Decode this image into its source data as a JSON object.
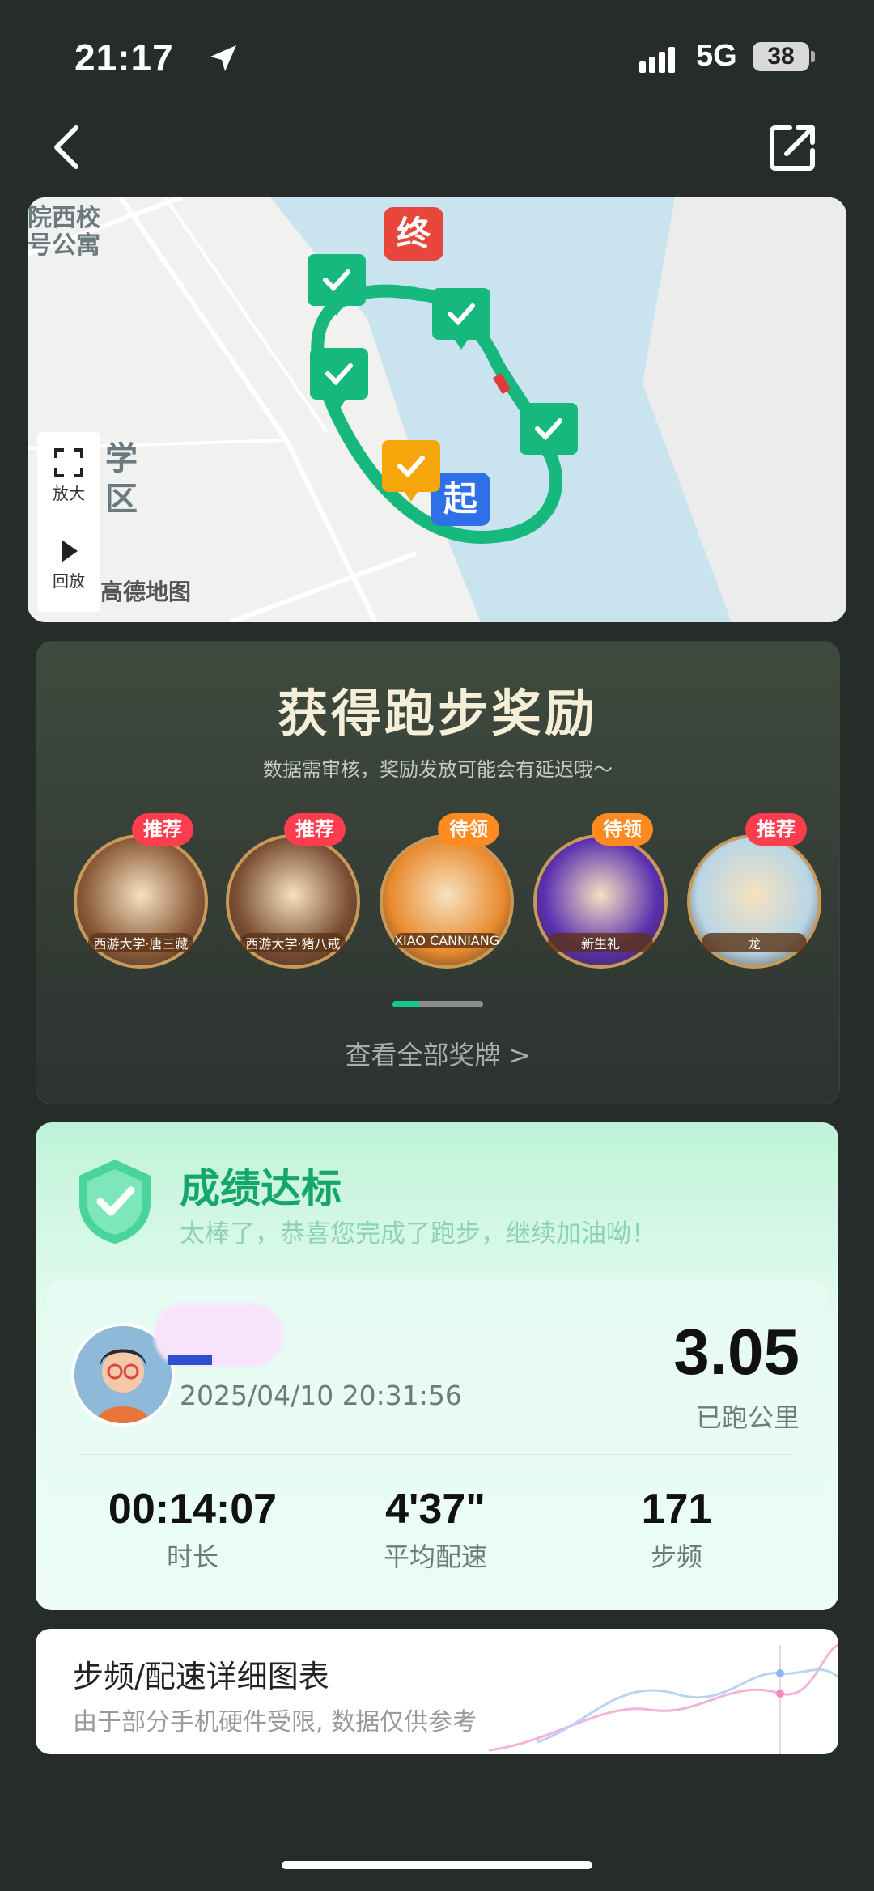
{
  "status_bar": {
    "time": "21:17",
    "network": "5G",
    "battery": "38"
  },
  "map": {
    "place_text_1": "院西校",
    "place_text_2": "号公寓",
    "place_text_3": "学",
    "place_text_4": "区",
    "zoom_label": "放大",
    "replay_label": "回放",
    "provider": "高德地图",
    "end_marker": "终",
    "start_marker": "起"
  },
  "reward": {
    "title": "获得跑步奖励",
    "subtitle": "数据需审核，奖励发放可能会有延迟哦～",
    "medals": [
      {
        "tag": "推荐",
        "tag_type": "recommend",
        "caption": "西游大学·唐三藏",
        "color": "#8a5a3a"
      },
      {
        "tag": "推荐",
        "tag_type": "recommend",
        "caption": "西游大学·猪八戒",
        "color": "#7a4e34"
      },
      {
        "tag": "待领",
        "tag_type": "claim",
        "caption": "XIAO CANNIANG",
        "color": "#e98a2e"
      },
      {
        "tag": "待领",
        "tag_type": "claim",
        "caption": "新生礼",
        "color": "#5a2fb0"
      },
      {
        "tag": "推荐",
        "tag_type": "recommend",
        "caption": "龙",
        "color": "#b9d6e6"
      }
    ],
    "view_all": "查看全部奖牌 >"
  },
  "result": {
    "title": "成绩达标",
    "subtitle": "太棒了，恭喜您完成了跑步，继续加油呦！",
    "date": "2025/04/10 20:31:56",
    "distance": "3.05",
    "distance_label": "已跑公里",
    "stats": [
      {
        "value": "00:14:07",
        "label": "时长"
      },
      {
        "value": "4'37\"",
        "label": "平均配速"
      },
      {
        "value": "171",
        "label": "步频"
      }
    ]
  },
  "chart_card": {
    "title": "步频/配速详细图表",
    "subtitle": "由于部分手机硬件受限, 数据仅供参考"
  }
}
